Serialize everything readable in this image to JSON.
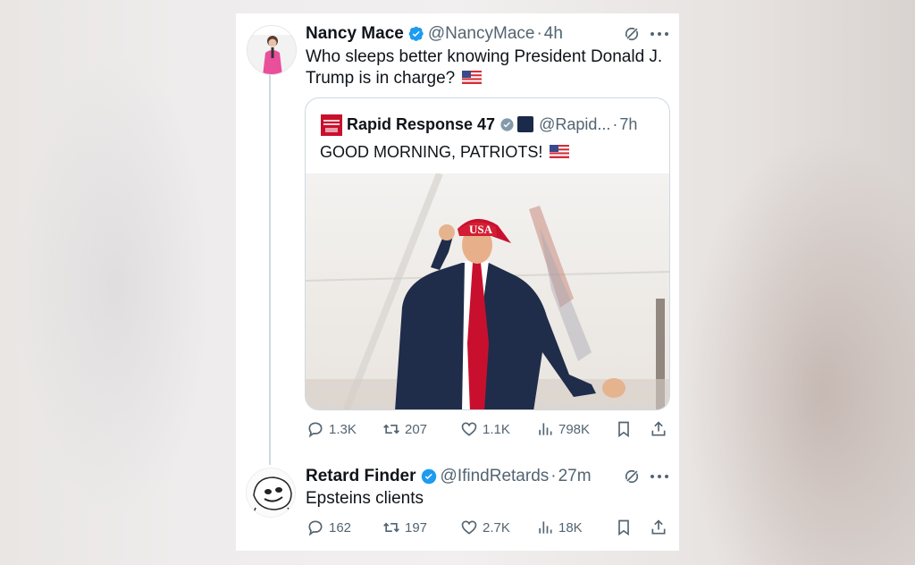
{
  "tweet1": {
    "name": "Nancy Mace",
    "handle": "@NancyMace",
    "dot": "·",
    "time": "4h",
    "text": "Who sleeps better knowing President Donald J. Trump is in charge?",
    "flag_icon": "us-flag-icon"
  },
  "quote": {
    "name": "Rapid Response 47",
    "handle": "@Rapid...",
    "dot": "·",
    "time": "7h",
    "text": "GOOD MORNING, PATRIOTS!",
    "photo_cap_text": "USA"
  },
  "tweet1_actions": {
    "replies": "1.3K",
    "reposts": "207",
    "likes": "1.1K",
    "views": "798K"
  },
  "tweet2": {
    "name": "Retard Finder",
    "handle": "@IfindRetards",
    "dot": "·",
    "time": "27m",
    "text": "Epsteins clients"
  },
  "tweet2_actions": {
    "replies": "162",
    "reposts": "197",
    "likes": "2.7K",
    "views": "18K"
  },
  "colors": {
    "verified_blue": "#1d9bf0",
    "secondary_text": "#536471",
    "border": "#cfd9de",
    "cap_red": "#c8102e"
  }
}
